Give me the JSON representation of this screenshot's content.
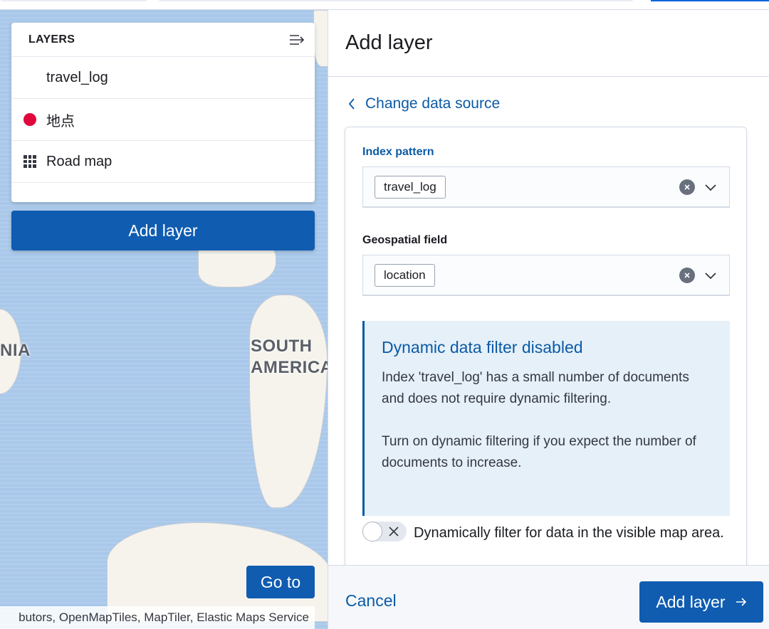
{
  "map": {
    "labels": {
      "south_america": "SOUTH\nAMERICA",
      "oceania_fragment": "NIA",
      "north_america_fragment": "AMERICA"
    },
    "layers_panel": {
      "title": "LAYERS",
      "layers": [
        {
          "name": "travel_log",
          "icon": "none"
        },
        {
          "name": "地点",
          "icon": "red-dot-icon",
          "color": "#e0073c"
        },
        {
          "name": "Road map",
          "icon": "grid-icon"
        }
      ]
    },
    "add_layer_label": "Add layer",
    "goto_label": "Go to",
    "attribution": "butors, OpenMapTiles, MapTiler, Elastic Maps Service"
  },
  "flyout": {
    "title": "Add layer",
    "change_source_label": "Change data source",
    "index_pattern": {
      "label": "Index pattern",
      "value": "travel_log"
    },
    "geo_field": {
      "label": "Geospatial field",
      "value": "location"
    },
    "callout": {
      "title": "Dynamic data filter disabled",
      "body1": "Index 'travel_log' has a small number of documents and does not require dynamic filtering.",
      "body2": "Turn on dynamic filtering if you expect the number of documents to increase."
    },
    "switch_label": "Dynamically filter for data in the visible map area.",
    "switch_on": false,
    "cancel_label": "Cancel",
    "add_layer_label": "Add layer"
  },
  "colors": {
    "primary": "#0f5cb1",
    "link": "#0b5ba6",
    "map_water": "#a9c8ea"
  }
}
